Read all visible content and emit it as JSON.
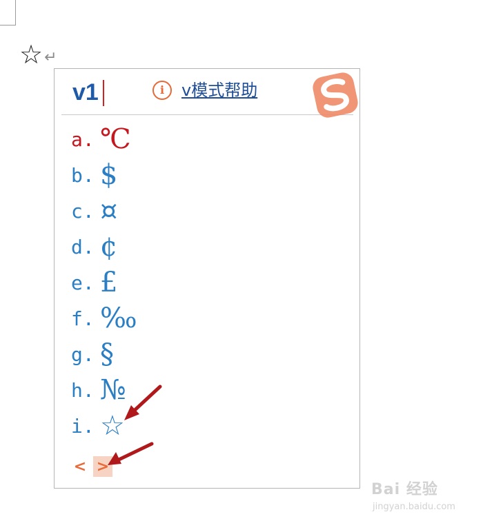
{
  "document": {
    "inserted_symbol": "☆",
    "paragraph_mark": "↵"
  },
  "ime": {
    "input_text": "v1",
    "help_link": "v模式帮助",
    "info_icon": "info-icon",
    "accent_color": "#e86a37",
    "candidates": [
      {
        "key": "a.",
        "symbol": "℃"
      },
      {
        "key": "b.",
        "symbol": "$"
      },
      {
        "key": "c.",
        "symbol": "¤"
      },
      {
        "key": "d.",
        "symbol": "¢"
      },
      {
        "key": "e.",
        "symbol": "£"
      },
      {
        "key": "f.",
        "symbol": "‰"
      },
      {
        "key": "g.",
        "symbol": "§"
      },
      {
        "key": "h.",
        "symbol": "№"
      },
      {
        "key": "i.",
        "symbol": "☆"
      }
    ],
    "pager": {
      "prev": "<",
      "next": ">"
    }
  },
  "annotations": {
    "arrow_color": "#b0191b"
  },
  "watermark": {
    "brand": "Bai 经验",
    "url": "jingyan.baidu.com"
  }
}
